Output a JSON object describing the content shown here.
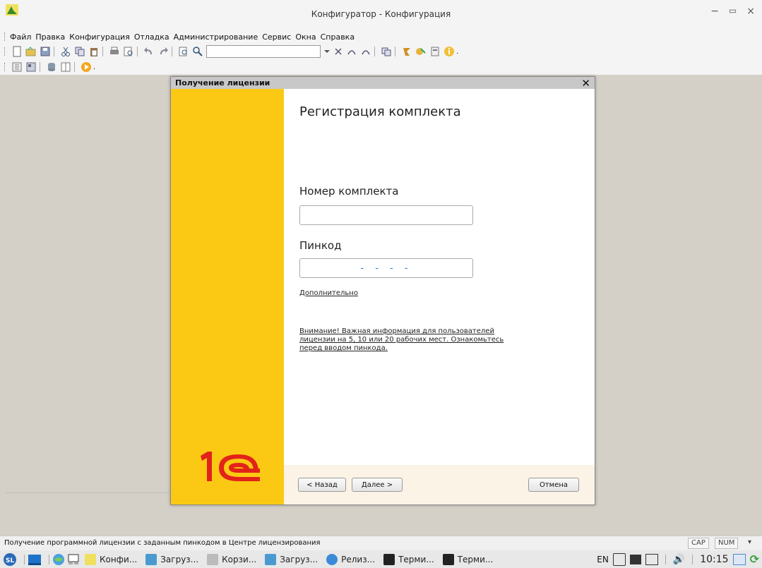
{
  "window": {
    "title": "Конфигуратор - Конфигурация",
    "minimize_glyph": "−",
    "close_glyph": "×"
  },
  "menu": [
    "Файл",
    "Правка",
    "Конфигурация",
    "Отладка",
    "Администрирование",
    "Сервис",
    "Окна",
    "Справка"
  ],
  "dialog": {
    "title": "Получение лицензии",
    "heading": "Регистрация комплекта",
    "set_number_label": "Номер комплекта",
    "set_number_value": "",
    "pincode_label": "Пинкод",
    "pincode_mask": "- - - -",
    "more_link": "Дополнительно",
    "notice_link": "Внимание! Важная информация для пользователей лицензии на 5, 10 или 20 рабочих мест. Ознакомьтесь перед вводом пинкода.",
    "back_button": "< Назад",
    "next_button": "Далее >",
    "cancel_button": "Отмена",
    "brand_color": "#fbc914",
    "logo_color": "#e2231a"
  },
  "status": {
    "text": "Получение программной лицензии с заданным пинкодом в Центре лицензирования",
    "cap": "CAP",
    "num": "NUM"
  },
  "taskbar": {
    "tasks": [
      "Конфи...",
      "Загруз...",
      "Корзи...",
      "Загруз...",
      "Релиз...",
      "Терми...",
      "Терми..."
    ],
    "lang": "EN",
    "clock": "10:15"
  }
}
